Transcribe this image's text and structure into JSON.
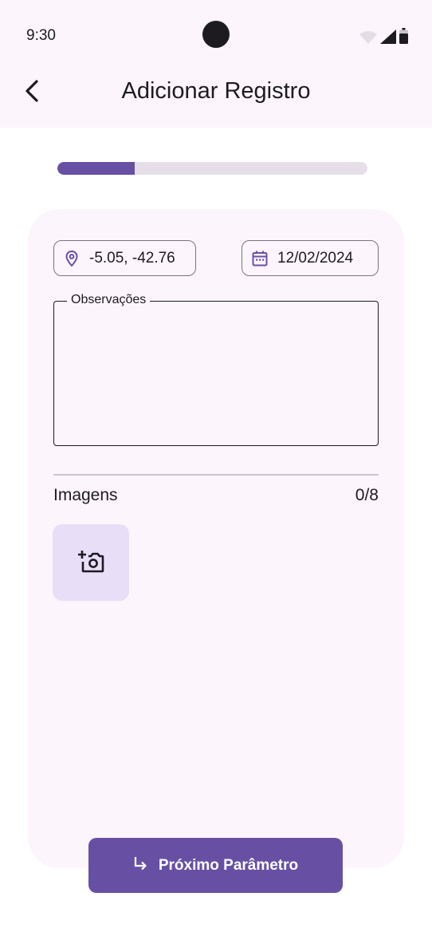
{
  "status_bar": {
    "time": "9:30",
    "icons": [
      "wifi-icon",
      "signal-icon",
      "battery-icon"
    ]
  },
  "header": {
    "back_icon": "arrow-back-icon",
    "title": "Adicionar Registro"
  },
  "progress": {
    "fraction": 0.25,
    "color": "#6750a4",
    "track_color": "#e6dfe9"
  },
  "form": {
    "location": {
      "icon": "location-pin-icon",
      "value": "-5.05, -42.76"
    },
    "date": {
      "icon": "calendar-icon",
      "value": "12/02/2024"
    },
    "observations": {
      "label": "Observações",
      "value": ""
    }
  },
  "images": {
    "label": "Imagens",
    "count": "0/8",
    "add_icon": "add-photo-icon"
  },
  "next_button": {
    "icon": "subdirectory-arrow-right-icon",
    "label": "Próximo Parâmetro"
  },
  "colors": {
    "primary": "#6750a4",
    "surface": "#fcf5fb",
    "secondary_container": "#e8def8"
  }
}
